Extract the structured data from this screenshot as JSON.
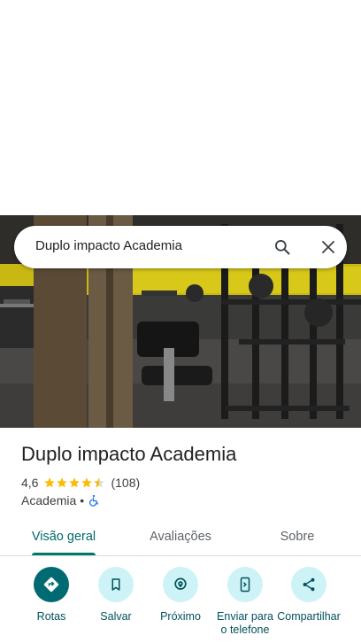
{
  "search": {
    "query": "Duplo impacto Academia"
  },
  "place": {
    "name": "Duplo impacto Academia",
    "rating": "4,6",
    "rating_value": 4.6,
    "review_count": "(108)",
    "category": "Academia",
    "separator": "•",
    "accessibility_icon": "wheelchair-accessible-icon"
  },
  "tabs": [
    {
      "label": "Visão geral",
      "active": true
    },
    {
      "label": "Avaliações",
      "active": false
    },
    {
      "label": "Sobre",
      "active": false
    }
  ],
  "actions": [
    {
      "label": "Rotas",
      "icon": "directions-icon"
    },
    {
      "label": "Salvar",
      "icon": "bookmark-icon"
    },
    {
      "label": "Próximo",
      "icon": "nearby-icon"
    },
    {
      "label": "Enviar para o telefone",
      "icon": "send-to-phone-icon"
    },
    {
      "label": "Compartilhar",
      "icon": "share-icon"
    }
  ],
  "colors": {
    "accent": "#006a73",
    "accent_light": "#cdf3f6",
    "tab_active": "#006a6a",
    "star": "#fbbc04"
  }
}
